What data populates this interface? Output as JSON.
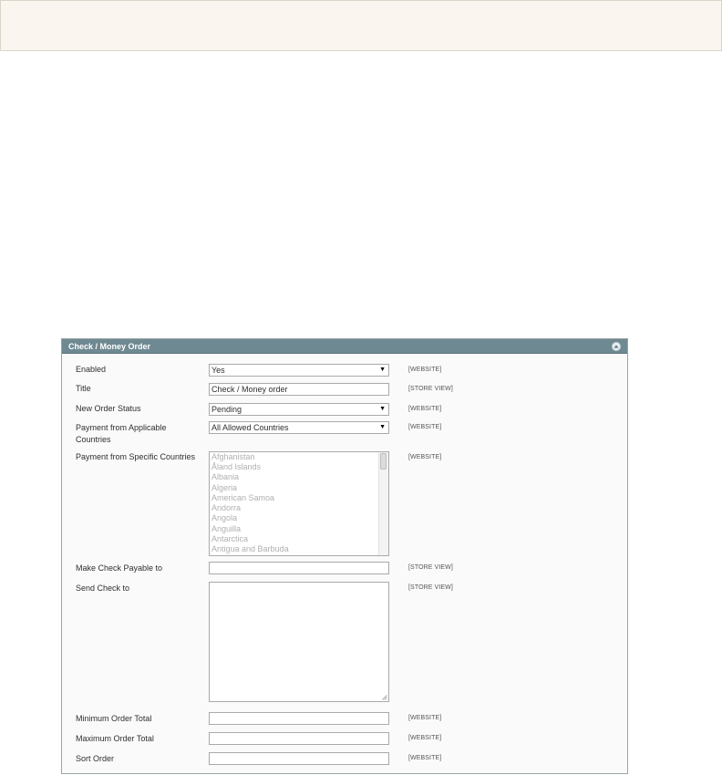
{
  "panel": {
    "title": "Check / Money Order"
  },
  "icons": {
    "collapse": "chevron-up-icon",
    "select_arrow": "dropdown-arrow-icon",
    "resize": "resize-grip-icon"
  },
  "colors": {
    "header_bg": "#6f8992",
    "notice_bg": "#faf6ef"
  },
  "fields": {
    "enabled": {
      "label": "Enabled",
      "value": "Yes",
      "scope": "[WEBSITE]"
    },
    "title": {
      "label": "Title",
      "value": "Check / Money order",
      "scope": "[STORE VIEW]"
    },
    "new_order_status": {
      "label": "New Order Status",
      "value": "Pending",
      "scope": "[WEBSITE]"
    },
    "payment_applicable": {
      "label": "Payment from Applicable Countries",
      "value": "All Allowed Countries",
      "scope": "[WEBSITE]"
    },
    "payment_specific": {
      "label": "Payment from Specific Countries",
      "scope": "[WEBSITE]",
      "options": [
        "Afghanistan",
        "Åland Islands",
        "Albania",
        "Algeria",
        "American Samoa",
        "Andorra",
        "Angola",
        "Anguilla",
        "Antarctica",
        "Antigua and Barbuda"
      ]
    },
    "payable_to": {
      "label": "Make Check Payable to",
      "value": "",
      "scope": "[STORE VIEW]"
    },
    "send_check_to": {
      "label": "Send Check to",
      "value": "",
      "scope": "[STORE VIEW]"
    },
    "min_total": {
      "label": "Minimum Order Total",
      "value": "",
      "scope": "[WEBSITE]"
    },
    "max_total": {
      "label": "Maximum Order Total",
      "value": "",
      "scope": "[WEBSITE]"
    },
    "sort_order": {
      "label": "Sort Order",
      "value": "",
      "scope": "[WEBSITE]"
    }
  }
}
